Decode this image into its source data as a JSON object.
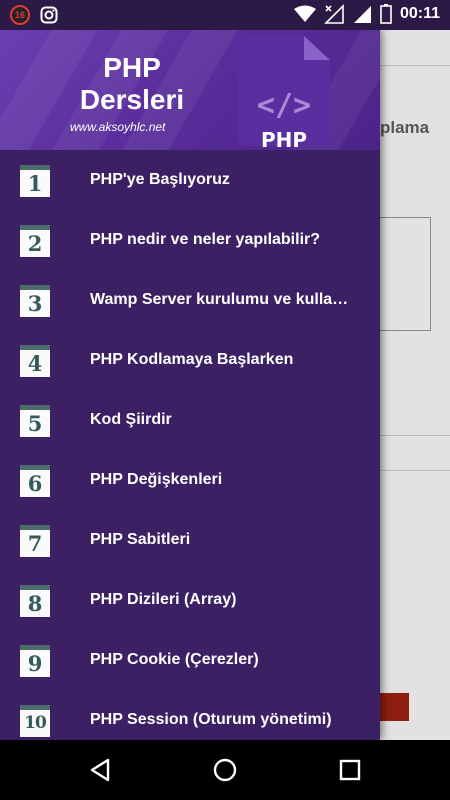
{
  "status_bar": {
    "notification_badge": "16",
    "time": "00:11",
    "icons": [
      "notification-badge-icon",
      "instagram-icon",
      "wifi-icon",
      "signal-icon",
      "battery-icon"
    ]
  },
  "background_app": {
    "partial_text": "plama"
  },
  "drawer": {
    "header": {
      "title": "PHP Dersleri",
      "url": "www.aksoyhlc.net",
      "logo_code": "</>",
      "logo_label": "PHP"
    },
    "items": [
      {
        "number": "1",
        "label": "PHP'ye Başlıyoruz"
      },
      {
        "number": "2",
        "label": "PHP nedir ve neler yapılabilir?"
      },
      {
        "number": "3",
        "label": "Wamp Server kurulumu ve kullanımı"
      },
      {
        "number": "4",
        "label": "PHP Kodlamaya Başlarken"
      },
      {
        "number": "5",
        "label": "Kod Şiirdir"
      },
      {
        "number": "6",
        "label": "PHP Değişkenleri"
      },
      {
        "number": "7",
        "label": "PHP Sabitleri"
      },
      {
        "number": "8",
        "label": "PHP Dizileri (Array)"
      },
      {
        "number": "9",
        "label": "PHP Cookie (Çerezler)"
      },
      {
        "number": "10",
        "label": "PHP Session (Oturum yönetimi)"
      }
    ]
  },
  "nav_bar": {
    "buttons": [
      "back-icon",
      "home-icon",
      "recents-icon"
    ]
  },
  "colors": {
    "status_bar": "#2b1a45",
    "drawer": "#3b2063",
    "header_gradient_start": "#6a3fb0",
    "accent_red": "#8e1d12",
    "calendar_top": "#4d6d6d"
  }
}
